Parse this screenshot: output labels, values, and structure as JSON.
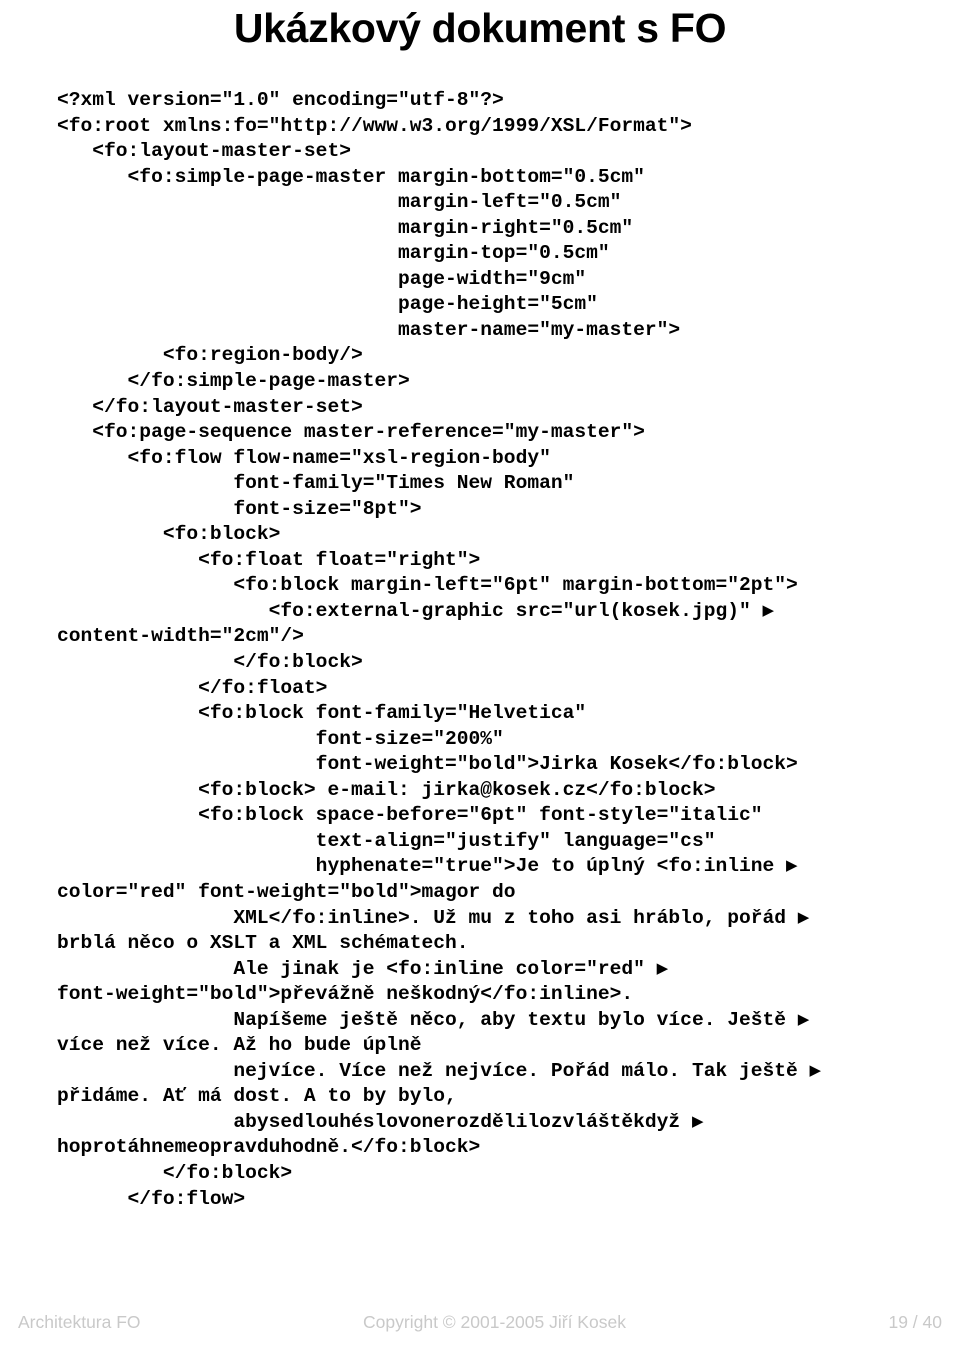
{
  "slide": {
    "title": "Ukázkový dokument s FO",
    "page_background": "#ffffff",
    "text_color": "#000000",
    "footer_color": "#c9c9c9"
  },
  "code": {
    "language": "xml",
    "wrap_marker": "▶",
    "lines": [
      "<?xml version=\"1.0\" encoding=\"utf-8\"?>",
      "<fo:root xmlns:fo=\"http://www.w3.org/1999/XSL/Format\">",
      "   <fo:layout-master-set>",
      "      <fo:simple-page-master margin-bottom=\"0.5cm\"",
      "                             margin-left=\"0.5cm\"",
      "                             margin-right=\"0.5cm\"",
      "                             margin-top=\"0.5cm\"",
      "                             page-width=\"9cm\"",
      "                             page-height=\"5cm\"",
      "                             master-name=\"my-master\">",
      "         <fo:region-body/>",
      "      </fo:simple-page-master>",
      "   </fo:layout-master-set>",
      "   <fo:page-sequence master-reference=\"my-master\">",
      "      <fo:flow flow-name=\"xsl-region-body\"",
      "               font-family=\"Times New Roman\"",
      "               font-size=\"8pt\">",
      "         <fo:block>",
      "            <fo:float float=\"right\">",
      "               <fo:block margin-left=\"6pt\" margin-bottom=\"2pt\">",
      "                  <fo:external-graphic src=\"url(kosek.jpg)\" ▶",
      "content-width=\"2cm\"/>",
      "               </fo:block>",
      "            </fo:float>",
      "            <fo:block font-family=\"Helvetica\"",
      "                      font-size=\"200%\"",
      "                      font-weight=\"bold\">Jirka Kosek</fo:block>",
      "            <fo:block> e-mail: jirka@kosek.cz</fo:block>",
      "            <fo:block space-before=\"6pt\" font-style=\"italic\"",
      "                      text-align=\"justify\" language=\"cs\"",
      "                      hyphenate=\"true\">Je to úplný <fo:inline ▶",
      "color=\"red\" font-weight=\"bold\">magor do",
      "               XML</fo:inline>. Už mu z toho asi hráblo, pořád ▶",
      "brblá něco o XSLT a XML schématech.",
      "               Ale jinak je <fo:inline color=\"red\" ▶",
      "font-weight=\"bold\">převážně neškodný</fo:inline>.",
      "               Napíšeme ještě něco, aby textu bylo více. Ještě ▶",
      "více než více. Až ho bude úplně",
      "               nejvíce. Více než nejvíce. Pořád málo. Tak ještě ▶",
      "přidáme. Ať má dost. A to by bylo,",
      "               abysedlouhéslovonerozdělilozvláštěkdyž ▶",
      "hoprotáhnemeopravduhodně.</fo:block>",
      "         </fo:block>",
      "      </fo:flow>"
    ]
  },
  "footer": {
    "left": "Architektura FO",
    "center": "Copyright © 2001-2005 Jiří Kosek",
    "right": "19 / 40"
  }
}
